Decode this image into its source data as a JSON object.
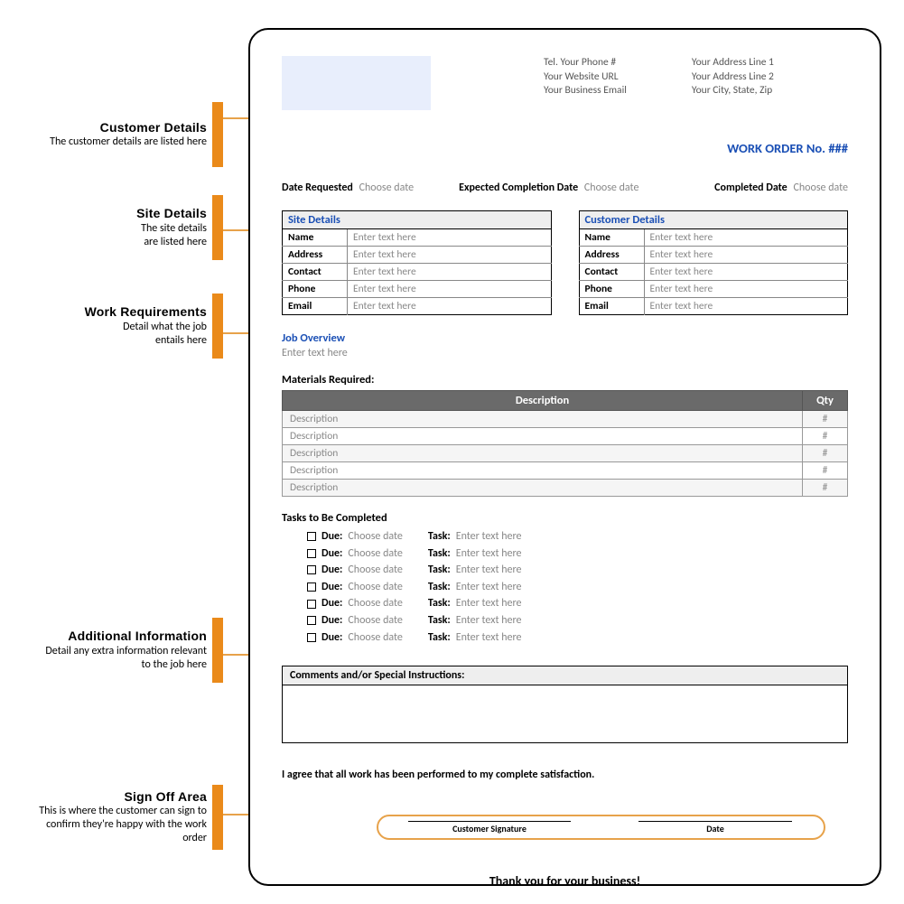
{
  "anno": {
    "cust": {
      "title": "Customer Details",
      "desc": "The customer details are listed here"
    },
    "site": {
      "title": "Site Details",
      "desc1": "The site details",
      "desc2": "are listed here"
    },
    "work": {
      "title": "Work Requirements",
      "desc1": "Detail what the job",
      "desc2": "entails here"
    },
    "addl": {
      "title": "Additional Information",
      "desc1": "Detail any extra information relevant",
      "desc2": "to the job here"
    },
    "sign": {
      "title": "Sign Off Area",
      "desc1": "This is where the customer can sign to",
      "desc2": "confirm they're happy with the work",
      "desc3": "order"
    }
  },
  "header": {
    "tel": "Tel. Your Phone #",
    "url": "Your Website URL",
    "email": "Your Business Email",
    "addr1": "Your Address Line 1",
    "addr2": "Your Address Line 2",
    "addr3": "Your City, State, Zip"
  },
  "work_order_label": "WORK ORDER No. ###",
  "dates": {
    "req_lbl": "Date Requested",
    "req_ph": "Choose date",
    "exp_lbl": "Expected Completion Date",
    "exp_ph": "Choose date",
    "cmp_lbl": "Completed Date",
    "cmp_ph": "Choose date"
  },
  "site_table": {
    "header": "Site Details",
    "rows": [
      {
        "k": "Name",
        "v": "Enter text here"
      },
      {
        "k": "Address",
        "v": "Enter text here"
      },
      {
        "k": "Contact",
        "v": "Enter text here"
      },
      {
        "k": "Phone",
        "v": "Enter text here"
      },
      {
        "k": "Email",
        "v": "Enter text here"
      }
    ]
  },
  "cust_table": {
    "header": "Customer Details",
    "rows": [
      {
        "k": "Name",
        "v": "Enter text here"
      },
      {
        "k": "Address",
        "v": "Enter text here"
      },
      {
        "k": "Contact",
        "v": "Enter text here"
      },
      {
        "k": "Phone",
        "v": "Enter text here"
      },
      {
        "k": "Email",
        "v": "Enter text here"
      }
    ]
  },
  "job": {
    "hdr": "Job Overview",
    "ph": "Enter text here"
  },
  "mats": {
    "title": "Materials Required:",
    "h1": "Description",
    "h2": "Qty",
    "rows": [
      {
        "d": "Description",
        "q": "#"
      },
      {
        "d": "Description",
        "q": "#"
      },
      {
        "d": "Description",
        "q": "#"
      },
      {
        "d": "Description",
        "q": "#"
      },
      {
        "d": "Description",
        "q": "#"
      }
    ]
  },
  "tasks": {
    "title": "Tasks to Be Completed",
    "due_lbl": "Due:",
    "due_ph": "Choose date",
    "task_lbl": "Task:",
    "task_ph": "Enter text here",
    "count": 7
  },
  "comments_hdr": "Comments and/or Special Instructions:",
  "agree": "I agree that all work has been performed to my complete satisfaction.",
  "sig": {
    "cust": "Customer Signature",
    "date": "Date"
  },
  "thanks": "Thank you for your business!"
}
